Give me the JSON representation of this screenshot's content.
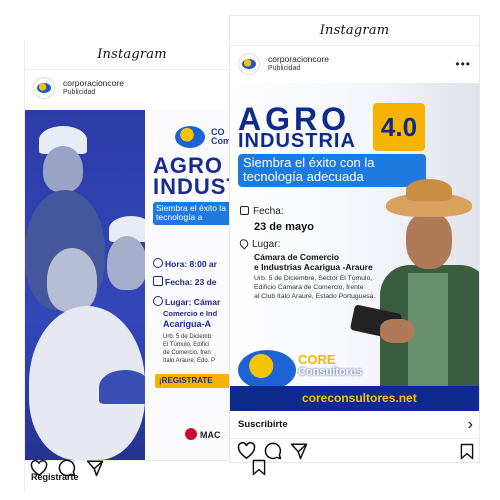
{
  "back_post": {
    "app_title": "Instagram",
    "username": "corporacioncore",
    "sponsored": "Publicidad",
    "cta_label": "Registrarte",
    "ad": {
      "logo_text": "CO Com",
      "title": "AGRO INDUSTRIA",
      "subtitle": "Siembra el éxito la tecnología a",
      "hora": "Hora: 8:00 ar",
      "fecha": "Fecha: 23 de",
      "lugar": "Lugar: Cámar",
      "lugar_line2": "Comercio e Ind",
      "lugar_line3": "Acarigua-A",
      "address1": "Urb. 5 de Diciemb",
      "address2": "El Túmulo, Edifici",
      "address3": "de Comercio, fren",
      "address4": "Italo Araure, Edo. P",
      "register": "¡REGISTRATE",
      "sponsor": "MAC"
    }
  },
  "front_post": {
    "app_title": "Instagram",
    "username": "corporacioncore",
    "sponsored": "Publicidad",
    "more_label": "•••",
    "cta_label": "Suscribirte",
    "cta_arrow": "›",
    "ad": {
      "title_line1": "AGRO",
      "title_line2": "INDUSTRIA",
      "badge": "4.0",
      "subtitle": "Siembra el éxito con la tecnología adecuada",
      "fecha_label": "Fecha:",
      "fecha_value": "23 de mayo",
      "lugar_label": "Lugar:",
      "lugar_value1": "Cámara de Comercio",
      "lugar_value2": "e Industrias Acarigua -Araure",
      "address1": "Urb. 5 de Diciembre, Sector El Túmulo,",
      "address2": "Edificio Cámara de Comercio, frente",
      "address3": "al Club Italo Araure, Estado Portuguesa.",
      "brand_core": "CORE",
      "brand_consultores": "Consultores",
      "url": "coreconsultores.net"
    }
  },
  "icons": [
    "heart-icon",
    "comment-icon",
    "share-icon",
    "bookmark-icon",
    "chevron-right-icon",
    "more-icon"
  ],
  "colors": {
    "brand_blue": "#0e2a8c",
    "accent_yellow": "#f6b400",
    "light_blue": "#1f7ae0"
  }
}
